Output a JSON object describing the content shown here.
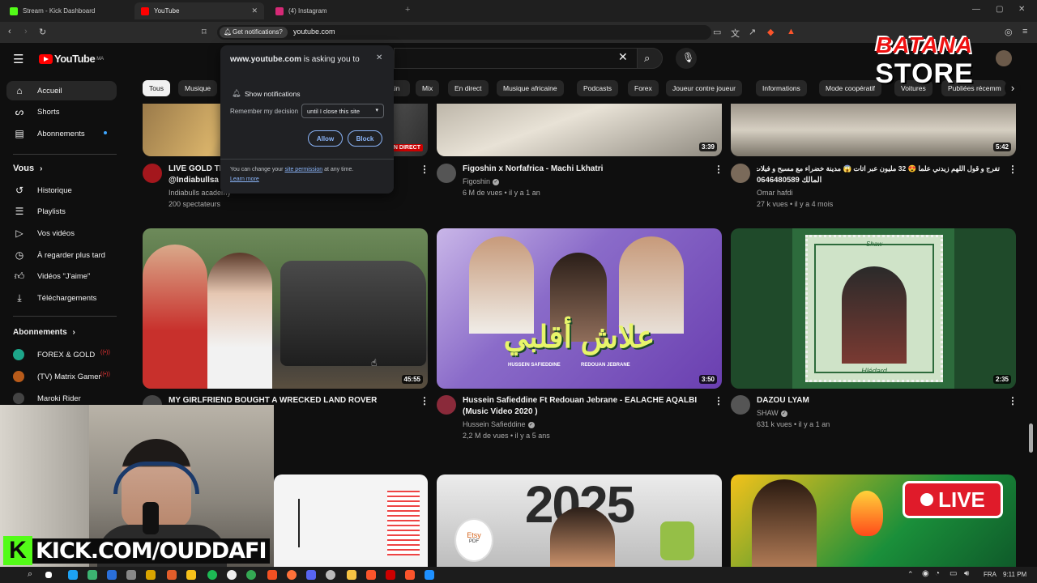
{
  "browser": {
    "tabs": [
      {
        "title": "Stream - Kick Dashboard",
        "fav_color": "#53fc18"
      },
      {
        "title": "YouTube",
        "fav_color": "#ff0000"
      },
      {
        "title": "(4) Instagram",
        "fav_color": "#d62976"
      }
    ],
    "notif_chip": "Get notifications?",
    "url": "youtube.com"
  },
  "popup": {
    "site": "www.youtube.com",
    "asking": " is asking you to",
    "perm_label": "Show notifications",
    "remember_label": "Remember my decision",
    "remember_value": "until I close this site",
    "allow": "Allow",
    "block": "Block",
    "footer_prefix": "You can change your ",
    "footer_link": "site permission",
    "footer_suffix": " at any time.",
    "learn_more": "Learn more"
  },
  "yt": {
    "logo": "YouTube",
    "logo_sup": "MA",
    "sidebar": {
      "main": [
        "Accueil",
        "Shorts",
        "Abonnements"
      ],
      "vous_header": "Vous",
      "vous": [
        "Historique",
        "Playlists",
        "Vos vidéos",
        "À regarder plus tard",
        "Vidéos \"J'aime\"",
        "Téléchargements"
      ],
      "subs_header": "Abonnements",
      "subs": [
        "FOREX & GOLD",
        "(TV) Matrix Gamer",
        "Maroki Rider"
      ]
    },
    "chips": [
      "Tous",
      "Musique",
      "ain",
      "Mix",
      "En direct",
      "Musique africaine",
      "Podcasts",
      "Forex",
      "Joueur contre joueur",
      "Informations",
      "Mode coopératif",
      "Voitures",
      "Publiées récemm"
    ],
    "row1": [
      {
        "title": "LIVE GOLD TI",
        "sub": "@Indiabullsa",
        "channel": "Indiabulls academy",
        "meta": "200 spectateurs",
        "badge": "EN DIRECT"
      },
      {
        "title": "Figoshin x Norfafrica - Machi Lkhatri",
        "channel": "Figoshin",
        "meta": "6 M de vues • il y a 1 an",
        "duration": "3:39"
      },
      {
        "title": "تفرج و قول اللهم زيدني علما 😍 32 مليون عبر اتات 😱 مدينة خضراء مع مسبح و فيلات",
        "sub": "0646480589 المالك",
        "channel": "Omar hafdi",
        "meta": "27 k vues • il y a 4 mois",
        "duration": "5:42"
      }
    ],
    "row2": [
      {
        "title": "MY GIRLFRIEND BOUGHT A WRECKED LAND ROVER",
        "duration": "45:55"
      },
      {
        "title": "Hussein Safieddine Ft Redouan Jebrane - EALACHE AQALBI (Music Video 2020 )",
        "channel": "Hussein Safieddine",
        "meta": "2,2 M de vues • il y a 5 ans",
        "duration": "3:50",
        "thumb_text": "علاش أقلبي",
        "thumb_small_left": "HUSSEIN SAFIEDDINE",
        "thumb_small_right": "REDOUAN JEBRANE"
      },
      {
        "title": "DAZOU LYAM",
        "channel": "SHAW",
        "meta": "631 k vues • il y a 1 an",
        "duration": "2:35",
        "stamp_top": "Shaw",
        "stamp_bottom": "Hlédard"
      }
    ],
    "row3": {
      "year": "2025",
      "live": "LIVE",
      "etsy": "Etsy",
      "pdf": "PDF"
    }
  },
  "overlay": {
    "store_line1": "BATANA",
    "store_line2": "STORE",
    "kick": "KICK.COM/OUDDAFI"
  },
  "taskbar": {
    "lang": "FRA",
    "time": "9:11 PM"
  }
}
